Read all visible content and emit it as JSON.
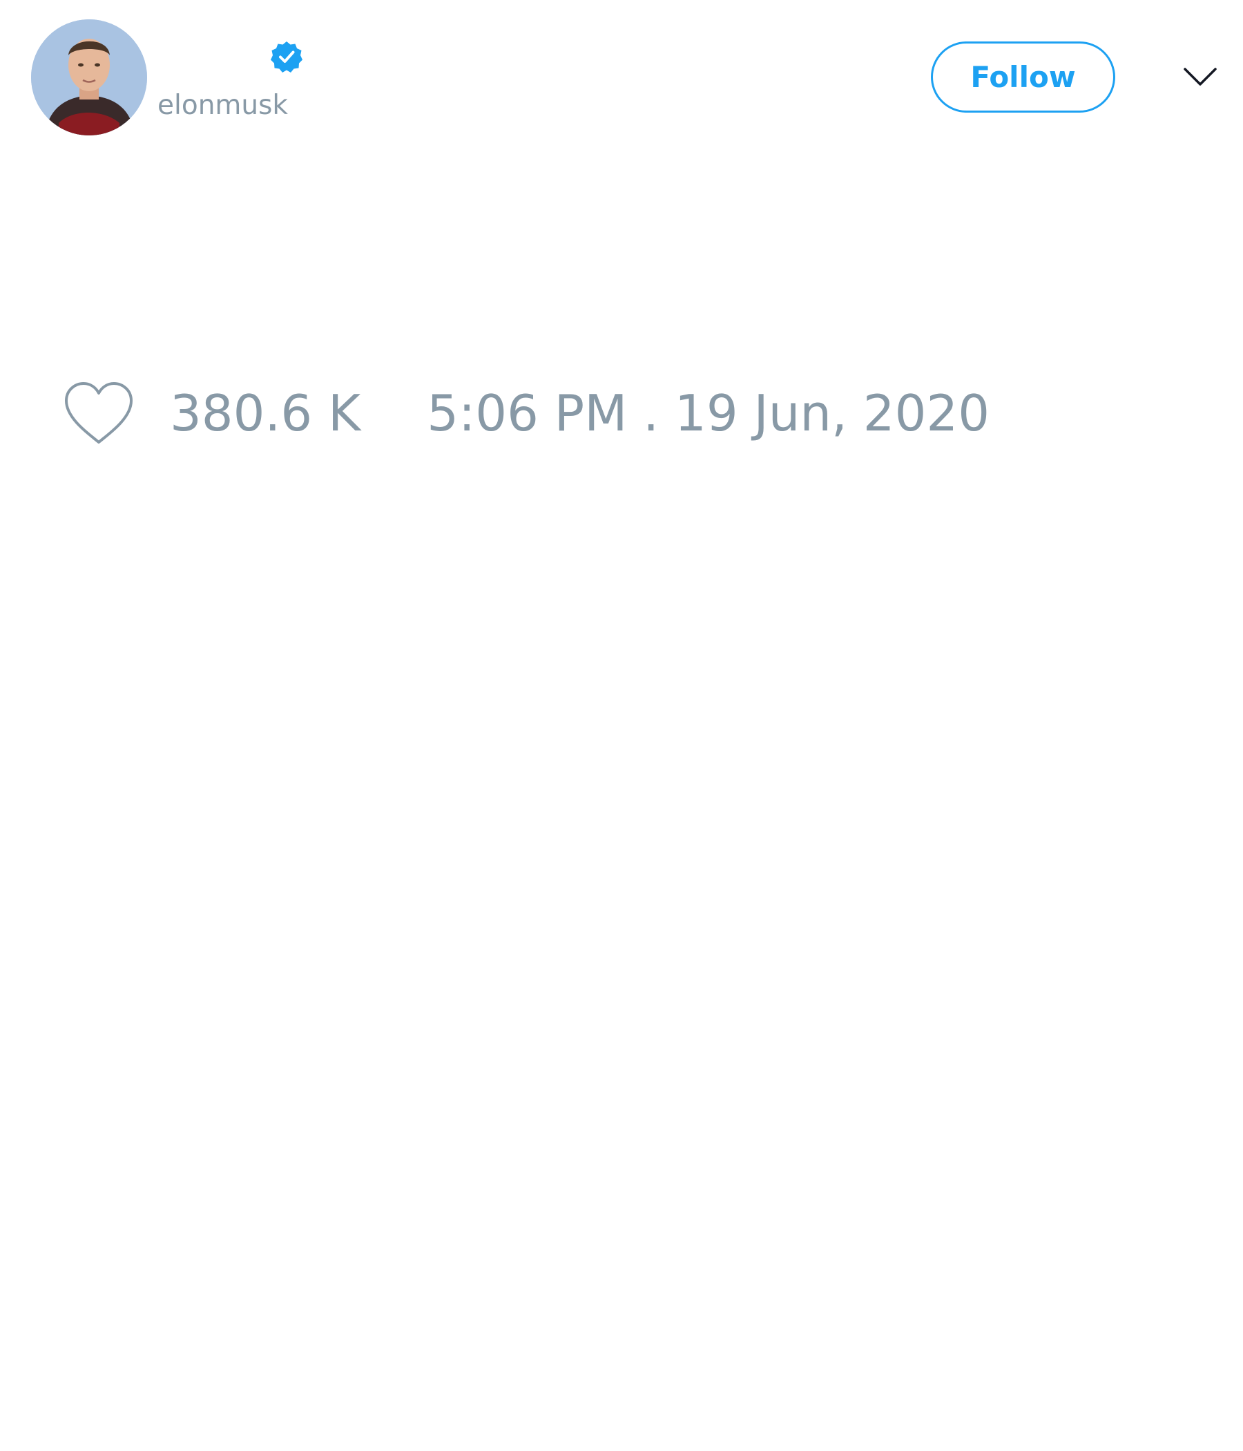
{
  "author": {
    "handle": "elonmusk",
    "verified": true,
    "avatar_icon": "profile-photo"
  },
  "header": {
    "follow_label": "Follow",
    "menu_icon": "chevron-down-icon"
  },
  "stats": {
    "like_icon": "heart-icon",
    "like_count": "380.6 K",
    "timestamp": "5:06 PM . 19 Jun, 2020"
  },
  "colors": {
    "accent": "#1da1f2",
    "muted_text": "#8899a6",
    "background": "#ffffff"
  }
}
